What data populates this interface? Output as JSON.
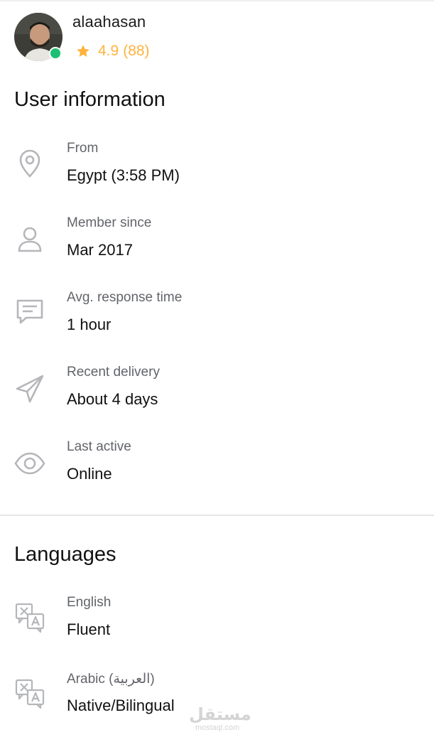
{
  "profile": {
    "username": "alaahasan",
    "rating": "4.9",
    "reviews": "(88)",
    "status": "online"
  },
  "user_info": {
    "title": "User information",
    "rows": [
      {
        "icon": "location-pin-icon",
        "label": "From",
        "value": "Egypt (3:58 PM)"
      },
      {
        "icon": "user-icon",
        "label": "Member since",
        "value": "Mar 2017"
      },
      {
        "icon": "chat-bubble-icon",
        "label": "Avg. response time",
        "value": "1 hour"
      },
      {
        "icon": "paper-plane-icon",
        "label": "Recent delivery",
        "value": "About 4 days"
      },
      {
        "icon": "eye-icon",
        "label": "Last active",
        "value": "Online"
      }
    ]
  },
  "languages": {
    "title": "Languages",
    "items": [
      {
        "icon": "translate-icon",
        "label": "English",
        "value": "Fluent"
      },
      {
        "icon": "translate-icon",
        "label": "Arabic (العربية)",
        "value": "Native/Bilingual"
      }
    ]
  },
  "watermark": {
    "main": "مستقل",
    "sub": "mostaql.com"
  },
  "colors": {
    "accent_star": "#ffb33e",
    "online": "#1dbf73",
    "icon_gray": "#b5b6ba",
    "label_gray": "#62646a"
  }
}
